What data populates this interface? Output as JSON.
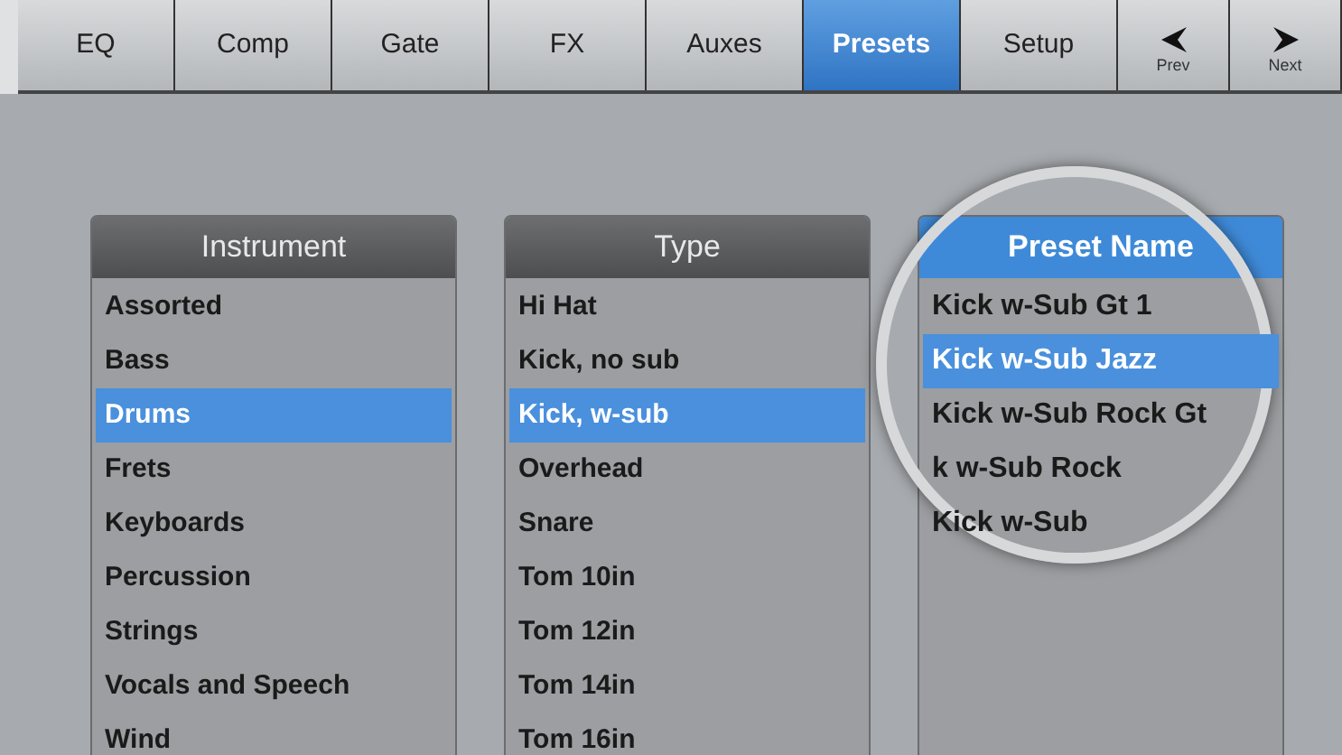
{
  "tabs": [
    {
      "label": "EQ",
      "selected": false
    },
    {
      "label": "Comp",
      "selected": false
    },
    {
      "label": "Gate",
      "selected": false
    },
    {
      "label": "FX",
      "selected": false
    },
    {
      "label": "Auxes",
      "selected": false
    },
    {
      "label": "Presets",
      "selected": true
    },
    {
      "label": "Setup",
      "selected": false
    }
  ],
  "nav_buttons": [
    {
      "label": "Prev",
      "kind": "prev"
    },
    {
      "label": "Next",
      "kind": "next"
    }
  ],
  "lists": [
    {
      "title": "Instrument",
      "highlight": false,
      "items": [
        {
          "label": "Assorted",
          "selected": false
        },
        {
          "label": "Bass",
          "selected": false
        },
        {
          "label": "Drums",
          "selected": true
        },
        {
          "label": "Frets",
          "selected": false
        },
        {
          "label": "Keyboards",
          "selected": false
        },
        {
          "label": "Percussion",
          "selected": false
        },
        {
          "label": "Strings",
          "selected": false
        },
        {
          "label": "Vocals and Speech",
          "selected": false
        },
        {
          "label": "Wind",
          "selected": false
        }
      ]
    },
    {
      "title": "Type",
      "highlight": false,
      "items": [
        {
          "label": "Hi Hat",
          "selected": false
        },
        {
          "label": "Kick, no sub",
          "selected": false
        },
        {
          "label": "Kick, w-sub",
          "selected": true
        },
        {
          "label": "Overhead",
          "selected": false
        },
        {
          "label": "Snare",
          "selected": false
        },
        {
          "label": "Tom 10in",
          "selected": false
        },
        {
          "label": "Tom 12in",
          "selected": false
        },
        {
          "label": "Tom 14in",
          "selected": false
        },
        {
          "label": "Tom 16in",
          "selected": false
        }
      ]
    },
    {
      "title": "Preset Name",
      "highlight": true,
      "items": [
        {
          "label": "Kick w-Sub Gt 1",
          "selected": false
        },
        {
          "label": "Kick w-Sub Jazz",
          "selected": true
        },
        {
          "label": "Kick w-Sub Rock Gt",
          "selected": false
        },
        {
          "label": "k w-Sub Rock",
          "selected": false
        },
        {
          "label": "Kick w-Sub",
          "selected": false
        }
      ]
    }
  ]
}
